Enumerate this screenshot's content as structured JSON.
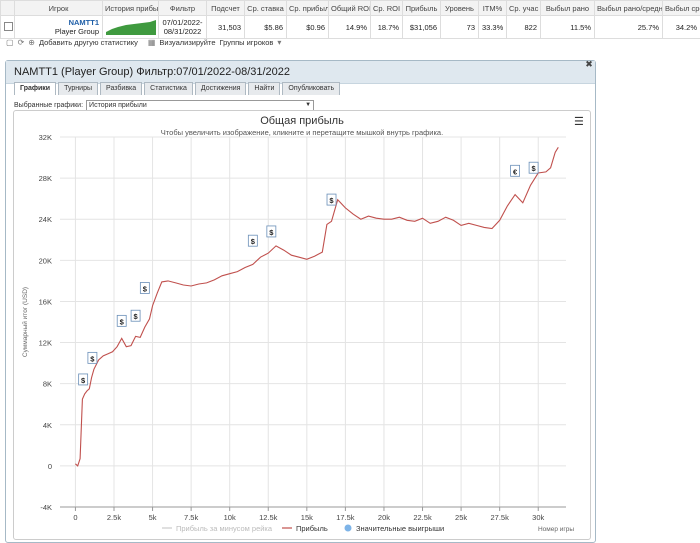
{
  "stats_table": {
    "headers": [
      "",
      "Игрок",
      "История прибыли",
      "Фильтр",
      "Подсчет",
      "Ср. ставка",
      "Ср. прибыл.",
      "Общий ROI",
      "Ср. ROI",
      "Прибыль",
      "Уровень",
      "ITM%",
      "Ср. учас",
      "Выбыл рано",
      "Выбыл рано/средне",
      "Выбыл сре"
    ],
    "row": {
      "player_name": "NAMTT1",
      "player_group": "Player Group",
      "filter_line1": "07/01/2022-",
      "filter_line2": "08/31/2022",
      "count": "31,503",
      "avg_stake": "$5.86",
      "avg_profit": "$0.96",
      "total_roi": "14.9%",
      "avg_roi": "18.7%",
      "profit": "$31,056",
      "level": "73",
      "itm": "33.3%",
      "avg_participants": "822",
      "early_out": "11.5%",
      "early_mid_out": "25.7%",
      "mid_out": "34.2%"
    }
  },
  "toolbar": {
    "add_stats": "Добавить другую статистику",
    "visualize": "Визуализируйте",
    "player_groups": "Группы игроков"
  },
  "panel": {
    "title": "NAMTT1 (Player Group) Фильтр:07/01/2022-08/31/2022",
    "tabs": [
      "Графики",
      "Турниры",
      "Разбивка",
      "Статистика",
      "Достижения",
      "Найти",
      "Опубликовать"
    ],
    "active_tab": "Графики",
    "select_label": "Выбранные графики:",
    "select_value": "История прибыли"
  },
  "chart_data": {
    "type": "line",
    "title": "Общая прибыль",
    "subtitle": "Чтобы увеличить изображение, кликните и перетащите мышкой внутрь графика.",
    "xlabel": "Номер игры",
    "ylabel": "Суммарный итог (USD)",
    "xlim": [
      -1000,
      31800
    ],
    "ylim": [
      -4000,
      32000
    ],
    "x_ticks": [
      "0",
      "2.5k",
      "5k",
      "7.5k",
      "10k",
      "12.5k",
      "15k",
      "17.5k",
      "20k",
      "22.5k",
      "25k",
      "27.5k",
      "30k"
    ],
    "y_ticks": [
      "-4K",
      "0",
      "4K",
      "8K",
      "12K",
      "16K",
      "20K",
      "24K",
      "28K",
      "32K"
    ],
    "grid": true,
    "legend": [
      "Прибыль за минусом рейка",
      "Прибыль",
      "Значительные выигрыши"
    ],
    "line_color": "#c0504d",
    "series": [
      {
        "name": "Прибыль",
        "x": [
          0,
          150,
          300,
          450,
          600,
          750,
          900,
          1050,
          1200,
          1500,
          1800,
          2100,
          2400,
          2700,
          3000,
          3300,
          3600,
          3900,
          4200,
          4500,
          4800,
          5000,
          5300,
          5600,
          6000,
          6500,
          7000,
          7500,
          8000,
          8500,
          9000,
          9500,
          10000,
          10500,
          11000,
          11500,
          12000,
          12500,
          13000,
          13500,
          14000,
          14500,
          15000,
          15500,
          16000,
          16300,
          16600,
          17000,
          17500,
          18000,
          18500,
          19000,
          19500,
          20000,
          20500,
          21000,
          21500,
          22000,
          22500,
          23000,
          23500,
          24000,
          24500,
          25000,
          25500,
          26000,
          26500,
          27000,
          27500,
          28000,
          28500,
          29000,
          29500,
          30000,
          30500,
          30800,
          31100,
          31300
        ],
        "y": [
          200,
          0,
          700,
          6500,
          7000,
          7300,
          7500,
          8600,
          9400,
          10300,
          10700,
          10900,
          11100,
          11600,
          12400,
          11600,
          11700,
          12600,
          12500,
          13500,
          14300,
          15600,
          16800,
          17900,
          18000,
          17800,
          17600,
          17500,
          17700,
          17800,
          18100,
          18500,
          18700,
          18900,
          19300,
          19600,
          20300,
          20700,
          21400,
          21000,
          20500,
          20300,
          20100,
          20400,
          20800,
          23500,
          23800,
          25900,
          25100,
          24500,
          24000,
          24300,
          24100,
          24000,
          24000,
          24200,
          23900,
          23800,
          24100,
          23600,
          23800,
          24200,
          23900,
          23400,
          23600,
          23400,
          23200,
          23100,
          23900,
          25300,
          26400,
          25600,
          27300,
          28500,
          28600,
          29000,
          30500,
          31000
        ]
      }
    ],
    "big_wins": [
      {
        "x": 500,
        "y": 7000,
        "symbol": "$"
      },
      {
        "x": 1100,
        "y": 9100,
        "symbol": "$"
      },
      {
        "x": 3000,
        "y": 12700,
        "symbol": "$"
      },
      {
        "x": 3900,
        "y": 13200,
        "symbol": "$"
      },
      {
        "x": 4500,
        "y": 15900,
        "symbol": "$"
      },
      {
        "x": 11500,
        "y": 20500,
        "symbol": "$"
      },
      {
        "x": 12700,
        "y": 21400,
        "symbol": "$"
      },
      {
        "x": 16600,
        "y": 24500,
        "symbol": "$"
      },
      {
        "x": 28500,
        "y": 27300,
        "symbol": "€"
      },
      {
        "x": 29700,
        "y": 27600,
        "symbol": "$"
      }
    ]
  }
}
